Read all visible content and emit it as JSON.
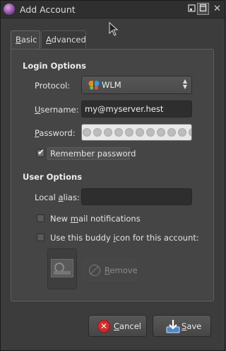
{
  "window": {
    "title": "Add Account"
  },
  "tabs": [
    {
      "label_accel": "B",
      "label_rest": "asic"
    },
    {
      "label_accel": "A",
      "label_rest": "dvanced"
    }
  ],
  "login": {
    "heading": "Login Options",
    "protocol": {
      "label": "Protocol:",
      "value": "WLM"
    },
    "username": {
      "label_accel": "U",
      "label_rest": "sername:",
      "value": "my@myserver.hest"
    },
    "password": {
      "label_accel": "P",
      "label_rest": "assword:",
      "mask_count": 13
    },
    "remember": {
      "label": "Remember password",
      "checked": true
    }
  },
  "user": {
    "heading": "User Options",
    "alias": {
      "label_pre": "Local ",
      "label_accel": "a",
      "label_rest": "lias:",
      "value": ""
    },
    "newmail": {
      "label_pre": "New ",
      "label_accel": "m",
      "label_rest": "ail notifications",
      "checked": false
    },
    "buddy": {
      "label_pre": "Use this buddy ",
      "label_accel": "i",
      "label_rest": "con for this account:",
      "checked": false
    },
    "remove": {
      "label_accel": "R",
      "label_rest": "emove"
    }
  },
  "buttons": {
    "cancel": {
      "label_accel": "C",
      "label_rest": "ancel"
    },
    "save": {
      "label_accel": "S",
      "label_rest": "ave"
    }
  },
  "icons": {
    "app": "pidgin-icon",
    "protocol": "wlm-butterfly-icon",
    "cancel": "cancel-icon",
    "save": "save-icon",
    "remove": "remove-icon"
  }
}
